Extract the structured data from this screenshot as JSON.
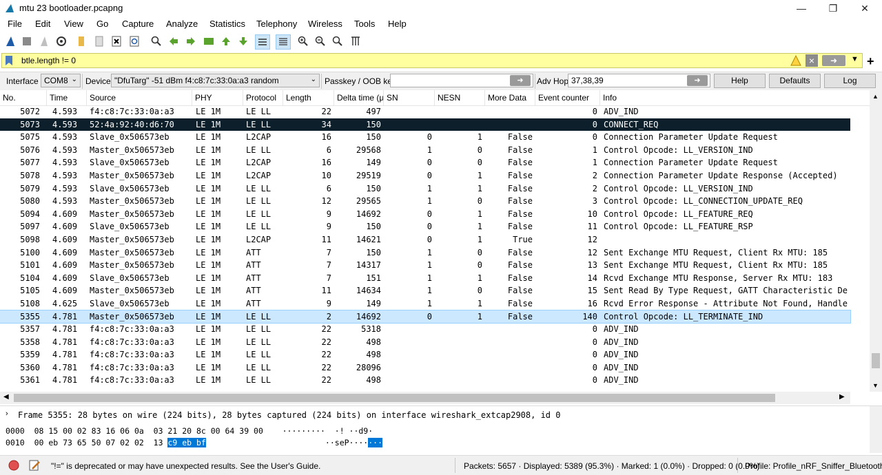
{
  "window": {
    "title": "mtu 23 bootloader.pcapng",
    "minimize": "—",
    "maximize": "❐",
    "close": "✕"
  },
  "menu": [
    "File",
    "Edit",
    "View",
    "Go",
    "Capture",
    "Analyze",
    "Statistics",
    "Telephony",
    "Wireless",
    "Tools",
    "Help"
  ],
  "filter": {
    "value": "btle.length != 0"
  },
  "interface_bar": {
    "interface_label": "Interface",
    "interface_value": "COM8",
    "device_label": "Device",
    "device_value": "\"DfuTarg\"  -51 dBm  f4:c8:7c:33:0a:a3  random",
    "passkey_label": "Passkey / OOB key",
    "passkey_value": "",
    "advhop_label": "Adv Hop",
    "advhop_value": "37,38,39",
    "help": "Help",
    "defaults": "Defaults",
    "log": "Log"
  },
  "columns": [
    "No.",
    "Time",
    "Source",
    "PHY",
    "Protocol",
    "Length",
    "Delta time (µs",
    "SN",
    "NESN",
    "More Data",
    "Event counter",
    "Info"
  ],
  "packets": [
    {
      "no": "5072",
      "time": "4.593",
      "src": "f4:c8:7c:33:0a:a3",
      "phy": "LE 1M",
      "proto": "LE LL",
      "len": "22",
      "delta": "497",
      "sn": "",
      "nesn": "",
      "more": "",
      "ev": "0",
      "info": "ADV_IND"
    },
    {
      "no": "5073",
      "time": "4.593",
      "src": "52:4a:92:40:d6:70",
      "phy": "LE 1M",
      "proto": "LE LL",
      "len": "34",
      "delta": "150",
      "sn": "",
      "nesn": "",
      "more": "",
      "ev": "0",
      "info": "CONNECT_REQ"
    },
    {
      "no": "5075",
      "time": "4.593",
      "src": "Slave_0x506573eb",
      "phy": "LE 1M",
      "proto": "L2CAP",
      "len": "16",
      "delta": "150",
      "sn": "0",
      "nesn": "1",
      "more": "False",
      "ev": "0",
      "info": "Connection Parameter Update Request"
    },
    {
      "no": "5076",
      "time": "4.593",
      "src": "Master_0x506573eb",
      "phy": "LE 1M",
      "proto": "LE LL",
      "len": "6",
      "delta": "29568",
      "sn": "1",
      "nesn": "0",
      "more": "False",
      "ev": "1",
      "info": "Control Opcode: LL_VERSION_IND"
    },
    {
      "no": "5077",
      "time": "4.593",
      "src": "Slave_0x506573eb",
      "phy": "LE 1M",
      "proto": "L2CAP",
      "len": "16",
      "delta": "149",
      "sn": "0",
      "nesn": "0",
      "more": "False",
      "ev": "1",
      "info": "Connection Parameter Update Request"
    },
    {
      "no": "5078",
      "time": "4.593",
      "src": "Master_0x506573eb",
      "phy": "LE 1M",
      "proto": "L2CAP",
      "len": "10",
      "delta": "29519",
      "sn": "0",
      "nesn": "1",
      "more": "False",
      "ev": "2",
      "info": "Connection Parameter Update Response (Accepted)"
    },
    {
      "no": "5079",
      "time": "4.593",
      "src": "Slave_0x506573eb",
      "phy": "LE 1M",
      "proto": "LE LL",
      "len": "6",
      "delta": "150",
      "sn": "1",
      "nesn": "1",
      "more": "False",
      "ev": "2",
      "info": "Control Opcode: LL_VERSION_IND"
    },
    {
      "no": "5080",
      "time": "4.593",
      "src": "Master_0x506573eb",
      "phy": "LE 1M",
      "proto": "LE LL",
      "len": "12",
      "delta": "29565",
      "sn": "1",
      "nesn": "0",
      "more": "False",
      "ev": "3",
      "info": "Control Opcode: LL_CONNECTION_UPDATE_REQ"
    },
    {
      "no": "5094",
      "time": "4.609",
      "src": "Master_0x506573eb",
      "phy": "LE 1M",
      "proto": "LE LL",
      "len": "9",
      "delta": "14692",
      "sn": "0",
      "nesn": "1",
      "more": "False",
      "ev": "10",
      "info": "Control Opcode: LL_FEATURE_REQ"
    },
    {
      "no": "5097",
      "time": "4.609",
      "src": "Slave_0x506573eb",
      "phy": "LE 1M",
      "proto": "LE LL",
      "len": "9",
      "delta": "150",
      "sn": "0",
      "nesn": "1",
      "more": "False",
      "ev": "11",
      "info": "Control Opcode: LL_FEATURE_RSP"
    },
    {
      "no": "5098",
      "time": "4.609",
      "src": "Master_0x506573eb",
      "phy": "LE 1M",
      "proto": "L2CAP",
      "len": "11",
      "delta": "14621",
      "sn": "0",
      "nesn": "1",
      "more": "True",
      "ev": "12",
      "info": ""
    },
    {
      "no": "5100",
      "time": "4.609",
      "src": "Master_0x506573eb",
      "phy": "LE 1M",
      "proto": "ATT",
      "len": "7",
      "delta": "150",
      "sn": "1",
      "nesn": "0",
      "more": "False",
      "ev": "12",
      "info": "Sent Exchange MTU Request, Client Rx MTU: 185"
    },
    {
      "no": "5101",
      "time": "4.609",
      "src": "Master_0x506573eb",
      "phy": "LE 1M",
      "proto": "ATT",
      "len": "7",
      "delta": "14317",
      "sn": "1",
      "nesn": "0",
      "more": "False",
      "ev": "13",
      "info": "Sent Exchange MTU Request, Client Rx MTU: 185"
    },
    {
      "no": "5104",
      "time": "4.609",
      "src": "Slave_0x506573eb",
      "phy": "LE 1M",
      "proto": "ATT",
      "len": "7",
      "delta": "151",
      "sn": "1",
      "nesn": "1",
      "more": "False",
      "ev": "14",
      "info": "Rcvd Exchange MTU Response, Server Rx MTU: 183"
    },
    {
      "no": "5105",
      "time": "4.609",
      "src": "Master_0x506573eb",
      "phy": "LE 1M",
      "proto": "ATT",
      "len": "11",
      "delta": "14634",
      "sn": "1",
      "nesn": "0",
      "more": "False",
      "ev": "15",
      "info": "Sent Read By Type Request, GATT Characteristic De"
    },
    {
      "no": "5108",
      "time": "4.625",
      "src": "Slave_0x506573eb",
      "phy": "LE 1M",
      "proto": "ATT",
      "len": "9",
      "delta": "149",
      "sn": "1",
      "nesn": "1",
      "more": "False",
      "ev": "16",
      "info": "Rcvd Error Response - Attribute Not Found, Handle"
    },
    {
      "no": "5355",
      "time": "4.781",
      "src": "Master_0x506573eb",
      "phy": "LE 1M",
      "proto": "LE LL",
      "len": "2",
      "delta": "14692",
      "sn": "0",
      "nesn": "1",
      "more": "False",
      "ev": "140",
      "info": "Control Opcode: LL_TERMINATE_IND"
    },
    {
      "no": "5357",
      "time": "4.781",
      "src": "f4:c8:7c:33:0a:a3",
      "phy": "LE 1M",
      "proto": "LE LL",
      "len": "22",
      "delta": "5318",
      "sn": "",
      "nesn": "",
      "more": "",
      "ev": "0",
      "info": "ADV_IND"
    },
    {
      "no": "5358",
      "time": "4.781",
      "src": "f4:c8:7c:33:0a:a3",
      "phy": "LE 1M",
      "proto": "LE LL",
      "len": "22",
      "delta": "498",
      "sn": "",
      "nesn": "",
      "more": "",
      "ev": "0",
      "info": "ADV_IND"
    },
    {
      "no": "5359",
      "time": "4.781",
      "src": "f4:c8:7c:33:0a:a3",
      "phy": "LE 1M",
      "proto": "LE LL",
      "len": "22",
      "delta": "498",
      "sn": "",
      "nesn": "",
      "more": "",
      "ev": "0",
      "info": "ADV_IND"
    },
    {
      "no": "5360",
      "time": "4.781",
      "src": "f4:c8:7c:33:0a:a3",
      "phy": "LE 1M",
      "proto": "LE LL",
      "len": "22",
      "delta": "28096",
      "sn": "",
      "nesn": "",
      "more": "",
      "ev": "0",
      "info": "ADV_IND"
    },
    {
      "no": "5361",
      "time": "4.781",
      "src": "f4:c8:7c:33:0a:a3",
      "phy": "LE 1M",
      "proto": "LE LL",
      "len": "22",
      "delta": "498",
      "sn": "",
      "nesn": "",
      "more": "",
      "ev": "0",
      "info": "ADV_IND"
    }
  ],
  "selected_row": "5073",
  "highlighted_row": "5355",
  "detail": {
    "text": "Frame 5355: 28 bytes on wire (224 bits), 28 bytes captured (224 bits) on interface wireshark_extcap2908, id 0"
  },
  "hex": {
    "line1_offset": "0000",
    "line1_bytes": "08 15 00 02 83 16 06 0a  03 21 20 8c 00 64 39 00",
    "line1_ascii": "·········  ·! ··d9·",
    "line2_offset": "0010",
    "line2_bytes": "00 eb 73 65 50 07 02 02  13",
    "line2_sel": "c9 eb bf",
    "line2_ascii": "··seP····",
    "line2_ascii_sel": "···"
  },
  "status": {
    "message": "\"!=\" is deprecated or may have unexpected results. See the User's Guide.",
    "packets": "Packets: 5657 · Displayed: 5389 (95.3%) · Marked: 1 (0.0%) · Dropped: 0 (0.0%)",
    "profile": "Profile: Profile_nRF_Sniffer_Bluetooth_LE"
  },
  "colors": {
    "filter_bg": "#ffffa0",
    "selected_bg": "#0c1f2b",
    "highlight_bg": "#cce8ff",
    "accent": "#0078d7"
  }
}
